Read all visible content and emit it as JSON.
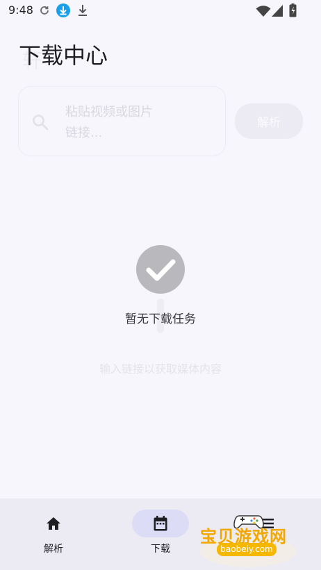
{
  "status_bar": {
    "time": "9:48",
    "icons": [
      "sync-icon",
      "download-circle-icon",
      "download-icon",
      "wifi-icon",
      "signal-icon",
      "battery-icon"
    ]
  },
  "header": {
    "title": "下载中心",
    "ghost_title": "轩"
  },
  "input": {
    "placeholder": "粘贴视频或图片\n链接...",
    "parse_label": "解析"
  },
  "empty_state": {
    "title": "暂无下载任务",
    "subtitle": "输入链接以获取媒体内容"
  },
  "bottom_nav": {
    "items": [
      {
        "label": "解析",
        "icon": "home-icon",
        "active": false
      },
      {
        "label": "下载",
        "icon": "calendar-icon",
        "active": true
      },
      {
        "label": "设置",
        "icon": "menu-icon",
        "active": false
      }
    ]
  },
  "watermark": {
    "text": "宝贝游戏网",
    "url": "baobeiy.com"
  },
  "colors": {
    "background": "#f7f6fd",
    "nav_background": "#eceaf3",
    "active_pill": "#dcdcf7",
    "check_circle": "#b9b9bd",
    "status_download_accent": "#1aa0e8"
  }
}
